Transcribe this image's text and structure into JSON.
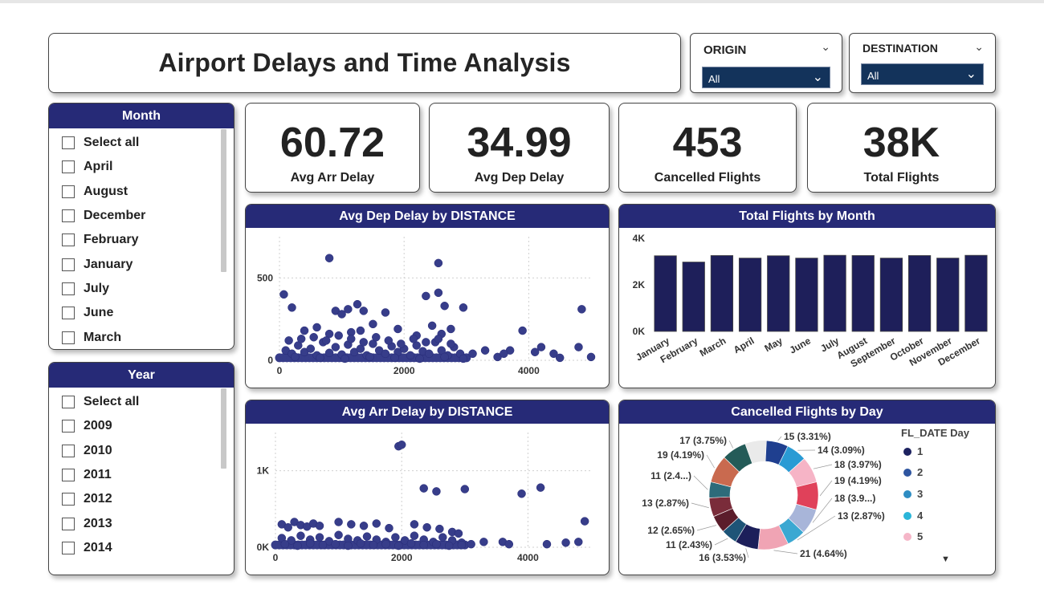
{
  "title": "Airport Delays and Time Analysis",
  "filters": {
    "origin": {
      "label": "ORIGIN",
      "value": "All"
    },
    "destination": {
      "label": "DESTINATION",
      "value": "All"
    }
  },
  "month_slicer": {
    "header": "Month",
    "items": [
      "Select all",
      "April",
      "August",
      "December",
      "February",
      "January",
      "July",
      "June",
      "March"
    ]
  },
  "year_slicer": {
    "header": "Year",
    "items": [
      "Select all",
      "2009",
      "2010",
      "2011",
      "2012",
      "2013",
      "2014"
    ]
  },
  "kpis": [
    {
      "value": "60.72",
      "label": "Avg Arr Delay"
    },
    {
      "value": "34.99",
      "label": "Avg Dep Delay"
    },
    {
      "value": "453",
      "label": "Cancelled Flights"
    },
    {
      "value": "38K",
      "label": "Total Flights"
    }
  ],
  "chart_data": [
    {
      "type": "scatter",
      "title": "Avg Dep Delay by DISTANCE",
      "xlabel": "",
      "ylabel": "",
      "x_ticks": [
        "0",
        "2000",
        "4000"
      ],
      "y_ticks": [
        "0",
        "500"
      ],
      "xlim": [
        0,
        5000
      ],
      "ylim": [
        0,
        750
      ],
      "grid": true,
      "color": "#373d8a",
      "points": [
        [
          800,
          620
        ],
        [
          2550,
          590
        ],
        [
          70,
          400
        ],
        [
          2550,
          410
        ],
        [
          200,
          320
        ],
        [
          1100,
          310
        ],
        [
          1250,
          340
        ],
        [
          1350,
          300
        ],
        [
          2350,
          390
        ],
        [
          2650,
          330
        ],
        [
          2950,
          320
        ],
        [
          1700,
          290
        ],
        [
          900,
          300
        ],
        [
          1000,
          280
        ],
        [
          1500,
          220
        ],
        [
          1900,
          190
        ],
        [
          2450,
          210
        ],
        [
          2750,
          190
        ],
        [
          4850,
          310
        ],
        [
          3900,
          180
        ],
        [
          1300,
          180
        ],
        [
          600,
          200
        ],
        [
          400,
          180
        ],
        [
          800,
          160
        ],
        [
          1150,
          170
        ],
        [
          2200,
          150
        ],
        [
          2600,
          160
        ],
        [
          3300,
          60
        ],
        [
          3700,
          60
        ],
        [
          4200,
          80
        ],
        [
          4400,
          40
        ],
        [
          4800,
          80
        ],
        [
          5000,
          20
        ],
        [
          3100,
          40
        ],
        [
          3500,
          20
        ],
        [
          4100,
          50
        ],
        [
          4500,
          15
        ],
        [
          3600,
          40
        ],
        [
          100,
          60
        ],
        [
          200,
          40
        ],
        [
          300,
          90
        ],
        [
          400,
          50
        ],
        [
          500,
          70
        ],
        [
          600,
          30
        ],
        [
          700,
          110
        ],
        [
          800,
          45
        ],
        [
          900,
          80
        ],
        [
          1000,
          35
        ],
        [
          1100,
          95
        ],
        [
          1200,
          50
        ],
        [
          1300,
          70
        ],
        [
          1400,
          30
        ],
        [
          1500,
          100
        ],
        [
          1600,
          60
        ],
        [
          1700,
          40
        ],
        [
          1800,
          85
        ],
        [
          1900,
          50
        ],
        [
          2000,
          70
        ],
        [
          2100,
          30
        ],
        [
          2200,
          90
        ],
        [
          2300,
          55
        ],
        [
          2400,
          40
        ],
        [
          2500,
          110
        ],
        [
          2600,
          60
        ],
        [
          2700,
          30
        ],
        [
          2800,
          80
        ],
        [
          2900,
          40
        ],
        [
          150,
          120
        ],
        [
          350,
          130
        ],
        [
          550,
          140
        ],
        [
          750,
          120
        ],
        [
          950,
          150
        ],
        [
          1150,
          130
        ],
        [
          1350,
          110
        ],
        [
          1550,
          140
        ],
        [
          1750,
          120
        ],
        [
          1950,
          100
        ],
        [
          2150,
          130
        ],
        [
          2350,
          110
        ],
        [
          2550,
          130
        ],
        [
          2750,
          100
        ],
        [
          250,
          20
        ],
        [
          650,
          15
        ],
        [
          1050,
          10
        ],
        [
          1450,
          20
        ],
        [
          1850,
          15
        ],
        [
          2250,
          10
        ],
        [
          2650,
          20
        ],
        [
          2950,
          10
        ]
      ]
    },
    {
      "type": "bar",
      "title": "Total Flights by Month",
      "xlabel": "",
      "ylabel": "",
      "categories": [
        "January",
        "February",
        "March",
        "April",
        "May",
        "June",
        "July",
        "August",
        "September",
        "October",
        "November",
        "December"
      ],
      "values": [
        3250,
        2980,
        3260,
        3150,
        3250,
        3150,
        3270,
        3260,
        3150,
        3260,
        3150,
        3270
      ],
      "y_ticks": [
        "0K",
        "2K",
        "4K"
      ],
      "ylim": [
        0,
        4000
      ],
      "color": "#1e1f5a"
    },
    {
      "type": "scatter",
      "title": "Avg Arr Delay by DISTANCE",
      "xlabel": "",
      "ylabel": "",
      "x_ticks": [
        "0",
        "2000",
        "4000"
      ],
      "y_ticks": [
        "0K",
        "1K"
      ],
      "xlim": [
        0,
        5000
      ],
      "ylim": [
        0,
        1500
      ],
      "grid": true,
      "color": "#373d8a",
      "points": [
        [
          1950,
          1320
        ],
        [
          2000,
          1340
        ],
        [
          2350,
          770
        ],
        [
          2550,
          730
        ],
        [
          3000,
          760
        ],
        [
          3900,
          700
        ],
        [
          4200,
          780
        ],
        [
          4900,
          340
        ],
        [
          4800,
          70
        ],
        [
          3300,
          70
        ],
        [
          3600,
          70
        ],
        [
          3700,
          40
        ],
        [
          4300,
          40
        ],
        [
          4600,
          60
        ],
        [
          3100,
          40
        ],
        [
          100,
          300
        ],
        [
          200,
          260
        ],
        [
          300,
          330
        ],
        [
          400,
          290
        ],
        [
          500,
          270
        ],
        [
          600,
          310
        ],
        [
          700,
          280
        ],
        [
          1000,
          330
        ],
        [
          1200,
          300
        ],
        [
          1400,
          280
        ],
        [
          1600,
          310
        ],
        [
          1800,
          250
        ],
        [
          2200,
          300
        ],
        [
          2400,
          260
        ],
        [
          2600,
          240
        ],
        [
          2800,
          200
        ],
        [
          2900,
          180
        ],
        [
          100,
          120
        ],
        [
          250,
          90
        ],
        [
          400,
          150
        ],
        [
          550,
          100
        ],
        [
          700,
          130
        ],
        [
          850,
          80
        ],
        [
          1000,
          160
        ],
        [
          1150,
          110
        ],
        [
          1300,
          90
        ],
        [
          1450,
          140
        ],
        [
          1600,
          100
        ],
        [
          1750,
          70
        ],
        [
          1900,
          130
        ],
        [
          2050,
          90
        ],
        [
          2200,
          150
        ],
        [
          2350,
          100
        ],
        [
          2500,
          70
        ],
        [
          2650,
          130
        ],
        [
          2800,
          90
        ],
        [
          2950,
          60
        ],
        [
          150,
          40
        ],
        [
          350,
          20
        ],
        [
          550,
          50
        ],
        [
          750,
          30
        ],
        [
          950,
          40
        ],
        [
          1150,
          20
        ],
        [
          1350,
          50
        ],
        [
          1550,
          30
        ],
        [
          1750,
          40
        ],
        [
          1950,
          20
        ],
        [
          2150,
          50
        ],
        [
          2350,
          30
        ],
        [
          2550,
          40
        ],
        [
          2750,
          20
        ],
        [
          2950,
          30
        ]
      ]
    },
    {
      "type": "pie",
      "title": "Cancelled Flights by Day",
      "legend_title": "FL_DATE Day",
      "legend": [
        "1",
        "2",
        "3",
        "4",
        "5"
      ],
      "legend_colors": [
        "#1d2260",
        "#2e55a0",
        "#2e8dc3",
        "#2bb5d9",
        "#f5b6c8"
      ],
      "slices": [
        {
          "label": "15 (3.31%)",
          "value": 3.31,
          "color": "#1f3f8f"
        },
        {
          "label": "14 (3.09%)",
          "value": 3.09,
          "color": "#2a9bd4"
        },
        {
          "label": "18 (3.97%)",
          "value": 3.97,
          "color": "#f6b4c6"
        },
        {
          "label": "19 (4.19%)",
          "value": 4.19,
          "color": "#e0415a"
        },
        {
          "label": "18 (3.9...)",
          "value": 3.9,
          "color": "#a8b5d9"
        },
        {
          "label": "13 (2.87%)",
          "value": 2.87,
          "color": "#3ba8d2"
        },
        {
          "label": "21 (4.64%)",
          "value": 4.64,
          "color": "#f0a4b4"
        },
        {
          "label": "16 (3.53%)",
          "value": 3.53,
          "color": "#1c1f5a"
        },
        {
          "label": "11 (2.43%)",
          "value": 2.43,
          "color": "#1e5477"
        },
        {
          "label": "12 (2.65%)",
          "value": 2.65,
          "color": "#5b1d2b"
        },
        {
          "label": "13 (2.87%)",
          "value": 2.87,
          "color": "#7a2c3a"
        },
        {
          "label": "11 (2.4...)",
          "value": 2.4,
          "color": "#2d6b7a"
        },
        {
          "label": "19 (4.19%)",
          "value": 4.19,
          "color": "#c96a4f"
        },
        {
          "label": "17 (3.75%)",
          "value": 3.75,
          "color": "#245b58"
        }
      ]
    }
  ]
}
